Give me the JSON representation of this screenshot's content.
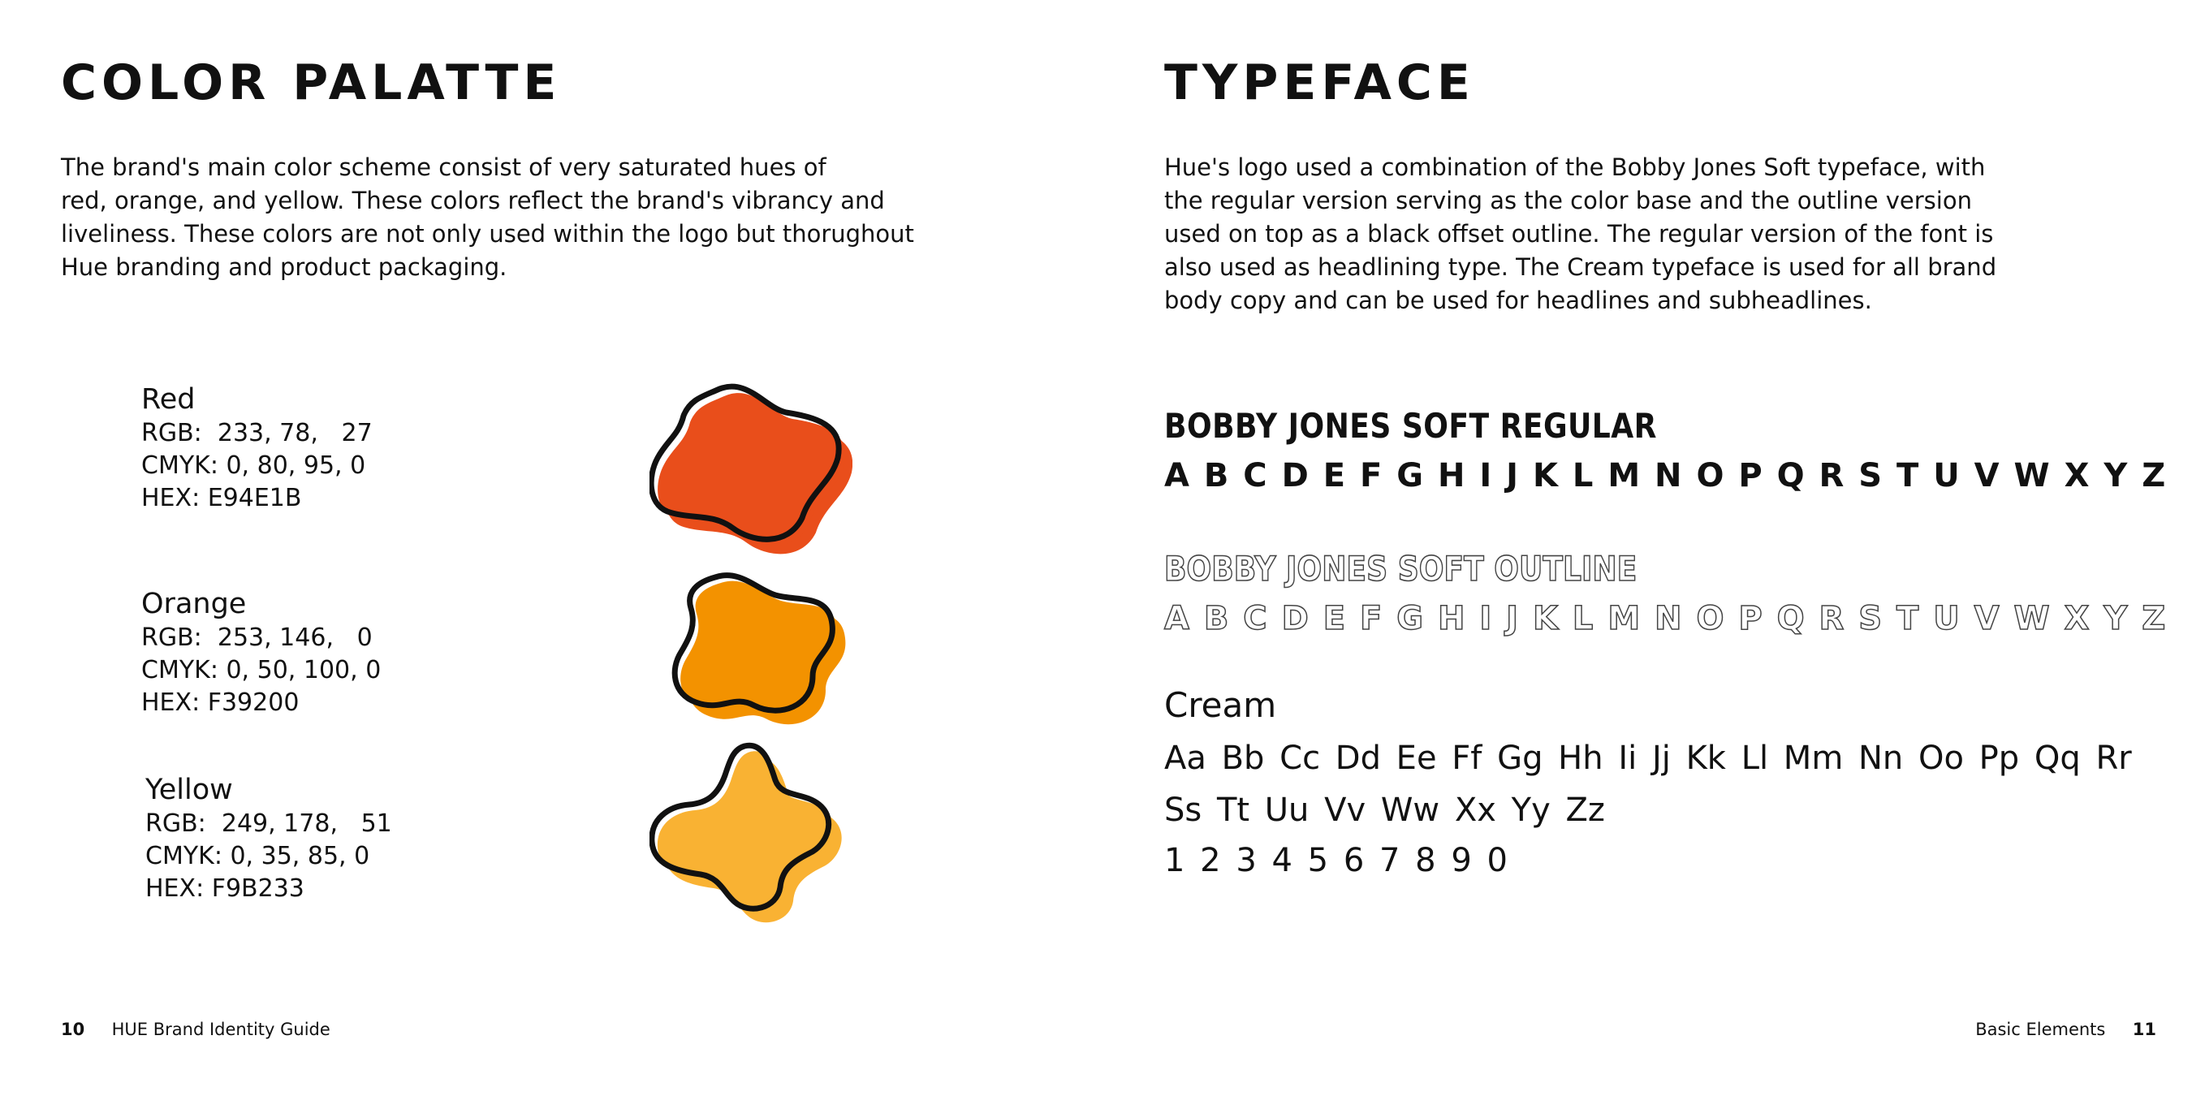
{
  "left_page": {
    "headline": "COLOR PALATTE",
    "body": "The brand's main color scheme consist of very saturated hues of\nred, orange, and yellow. These colors reflect the brand's vibrancy and\nliveliness. These colors are not only used within the logo but thorughout\nHue branding and product packaging.",
    "swatches": [
      {
        "name": "Red",
        "rgb": "RGB:  233, 78,   27",
        "cmyk": "CMYK: 0, 80, 95, 0",
        "hex": "HEX: E94E1B",
        "color": "#E94E1B"
      },
      {
        "name": "Orange",
        "rgb": "RGB:  253, 146,   0",
        "cmyk": "CMYK: 0, 50, 100, 0",
        "hex": "HEX: F39200",
        "color": "#F39200"
      },
      {
        "name": "Yellow",
        "rgb": "RGB:  249, 178,   51",
        "cmyk": "CMYK: 0, 35, 85, 0",
        "hex": "HEX: F9B233",
        "color": "#F9B233"
      }
    ],
    "footer": {
      "page_number": "10",
      "label": "HUE Brand Identity Guide"
    }
  },
  "right_page": {
    "headline": "TYPEFACE",
    "body": "Hue's logo used a combination of the Bobby Jones Soft typeface, with\nthe regular version serving as the color base and the outline version\nused on top as a black offset outline. The regular version of the font is\nalso used as headlining type. The Cream typeface is used for all brand\nbody copy and can be used for headlines and subheadlines.",
    "specimens": {
      "bobby_regular_title": "BOBBY JONES SOFT REGULAR",
      "bobby_regular_alphabet": "A B C D E F G H I J K L M N O P Q R S T U V W X Y Z",
      "bobby_outline_title": "BOBBY JONES SOFT OUTLINE",
      "bobby_outline_alphabet": "A B C D E F G H I J K L M N O P Q R S T U V W X Y Z",
      "cream_title": "Cream",
      "cream_line_1": "Aa Bb Cc Dd Ee Ff Gg Hh Ii Jj Kk Ll Mm Nn Oo Pp Qq Rr",
      "cream_line_2": "Ss Tt Uu Vv Ww Xx Yy Zz",
      "cream_numbers": "1 2 3 4 5 6 7 8 9 0"
    },
    "footer": {
      "label": "Basic Elements",
      "page_number": "11"
    }
  }
}
